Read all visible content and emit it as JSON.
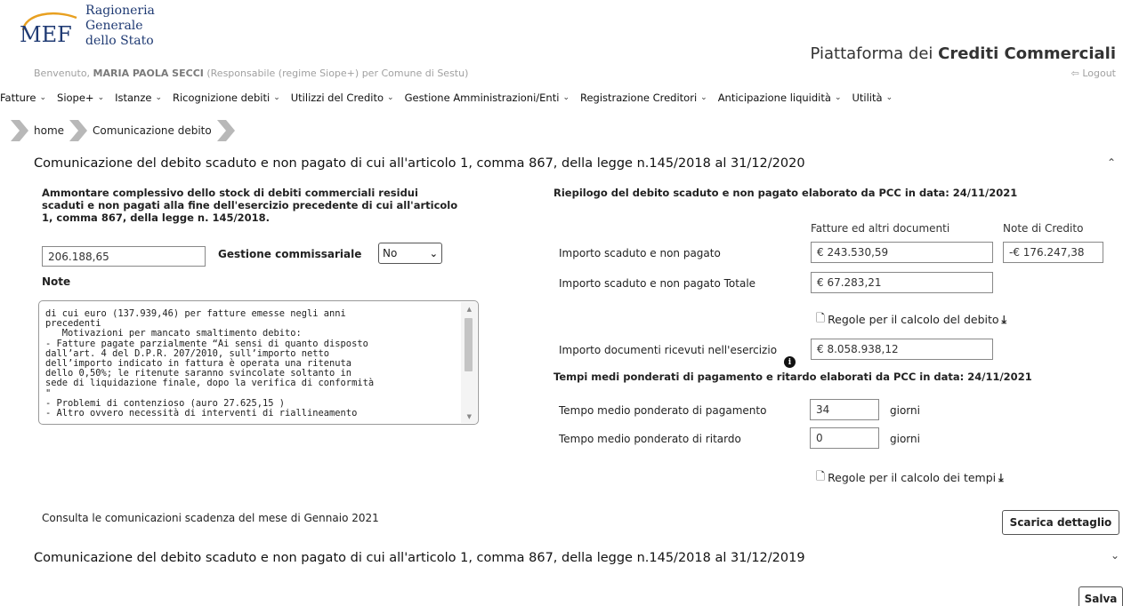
{
  "header": {
    "logo_abbr": "MEF",
    "logo_lines": [
      "Ragioneria",
      "Generale",
      "dello Stato"
    ],
    "app_title_prefix": "Piattaforma dei ",
    "app_title_strong": "Crediti Commerciali",
    "welcome_prefix": "Benvenuto, ",
    "welcome_user": "MARIA PAOLA SECCI",
    "welcome_suffix": " (Responsabile (regime Siope+) per Comune di Sestu)",
    "logout_label": "Logout"
  },
  "nav": {
    "items": [
      {
        "label": "Fatture"
      },
      {
        "label": "Siope+"
      },
      {
        "label": "Istanze"
      },
      {
        "label": "Ricognizione debiti"
      },
      {
        "label": "Utilizzi del Credito"
      },
      {
        "label": "Gestione Amministrazioni/Enti"
      },
      {
        "label": "Registrazione Creditori"
      },
      {
        "label": "Anticipazione liquidità"
      },
      {
        "label": "Utilità"
      }
    ]
  },
  "breadcrumb": {
    "home": "home",
    "current": "Comunicazione debito"
  },
  "section_2020": {
    "title": "Comunicazione del debito scaduto e non pagato di cui all'articolo 1, comma 867, della legge n.145/2018 al 31/12/2020",
    "left": {
      "heading": "Ammontare complessivo dello stock di debiti commerciali residui scaduti e non pagati alla fine dell'esercizio precedente di cui all'articolo 1, comma 867, della legge n. 145/2018.",
      "amount_value": "206.188,65",
      "gestione_label": "Gestione commissariale",
      "gestione_value": "No",
      "note_label": "Note",
      "note_text": "di cui euro (137.939,46) per fatture emesse negli anni\nprecedenti\n   Motivazioni per mancato smaltimento debito:\n- Fatture pagate parzialmente “Ai sensi di quanto disposto\ndall’art. 4 del D.P.R. 207/2010, sull’importo netto\ndell’importo indicato in fattura è operata una ritenuta\ndello 0,50%; le ritenute saranno svincolate soltanto in\nsede di liquidazione finale, dopo la verifica di conformità\n\"\n- Problemi di contenzioso (auro 27.625,15 )\n- Altro ovvero necessità di interventi di riallineamento"
    },
    "right": {
      "heading": "Riepilogo del debito scaduto e non pagato elaborato da PCC in data: 24/11/2021",
      "col_fatture": "Fatture ed altri documenti",
      "col_note": "Note di Credito",
      "importo_label": "Importo scaduto e non pagato",
      "importo_fatture": "€ 243.530,59",
      "importo_note": "-€ 176.247,38",
      "totale_label": "Importo scaduto e non pagato Totale",
      "totale_value": "€ 67.283,21",
      "regole_debito": "Regole per il calcolo del debito",
      "ricevuti_label": "Importo documenti ricevuti nell'esercizio",
      "ricevuti_value": "€ 8.058.938,12",
      "tempi_heading": "Tempi medi ponderati di pagamento e ritardo elaborati da PCC in data: 24/11/2021",
      "pagamento_label": "Tempo medio ponderato di pagamento",
      "pagamento_value": "34",
      "ritardo_label": "Tempo medio ponderato di ritardo",
      "ritardo_value": "0",
      "giorni": "giorni",
      "regole_tempi": "Regole per il calcolo dei tempi"
    },
    "consulta_text": "Consulta le comunicazioni scadenza del mese di Gennaio 2021",
    "scarica_label": "Scarica dettaglio"
  },
  "section_2019": {
    "title": "Comunicazione del debito scaduto e non pagato di cui all'articolo 1, comma 867, della legge n.145/2018 al 31/12/2019"
  },
  "salva_label": "Salva",
  "colors": {
    "brand_blue": "#1f3a73",
    "logo_orange": "#e8a020",
    "breadcrumb_arrow": "#b8b8b8"
  }
}
